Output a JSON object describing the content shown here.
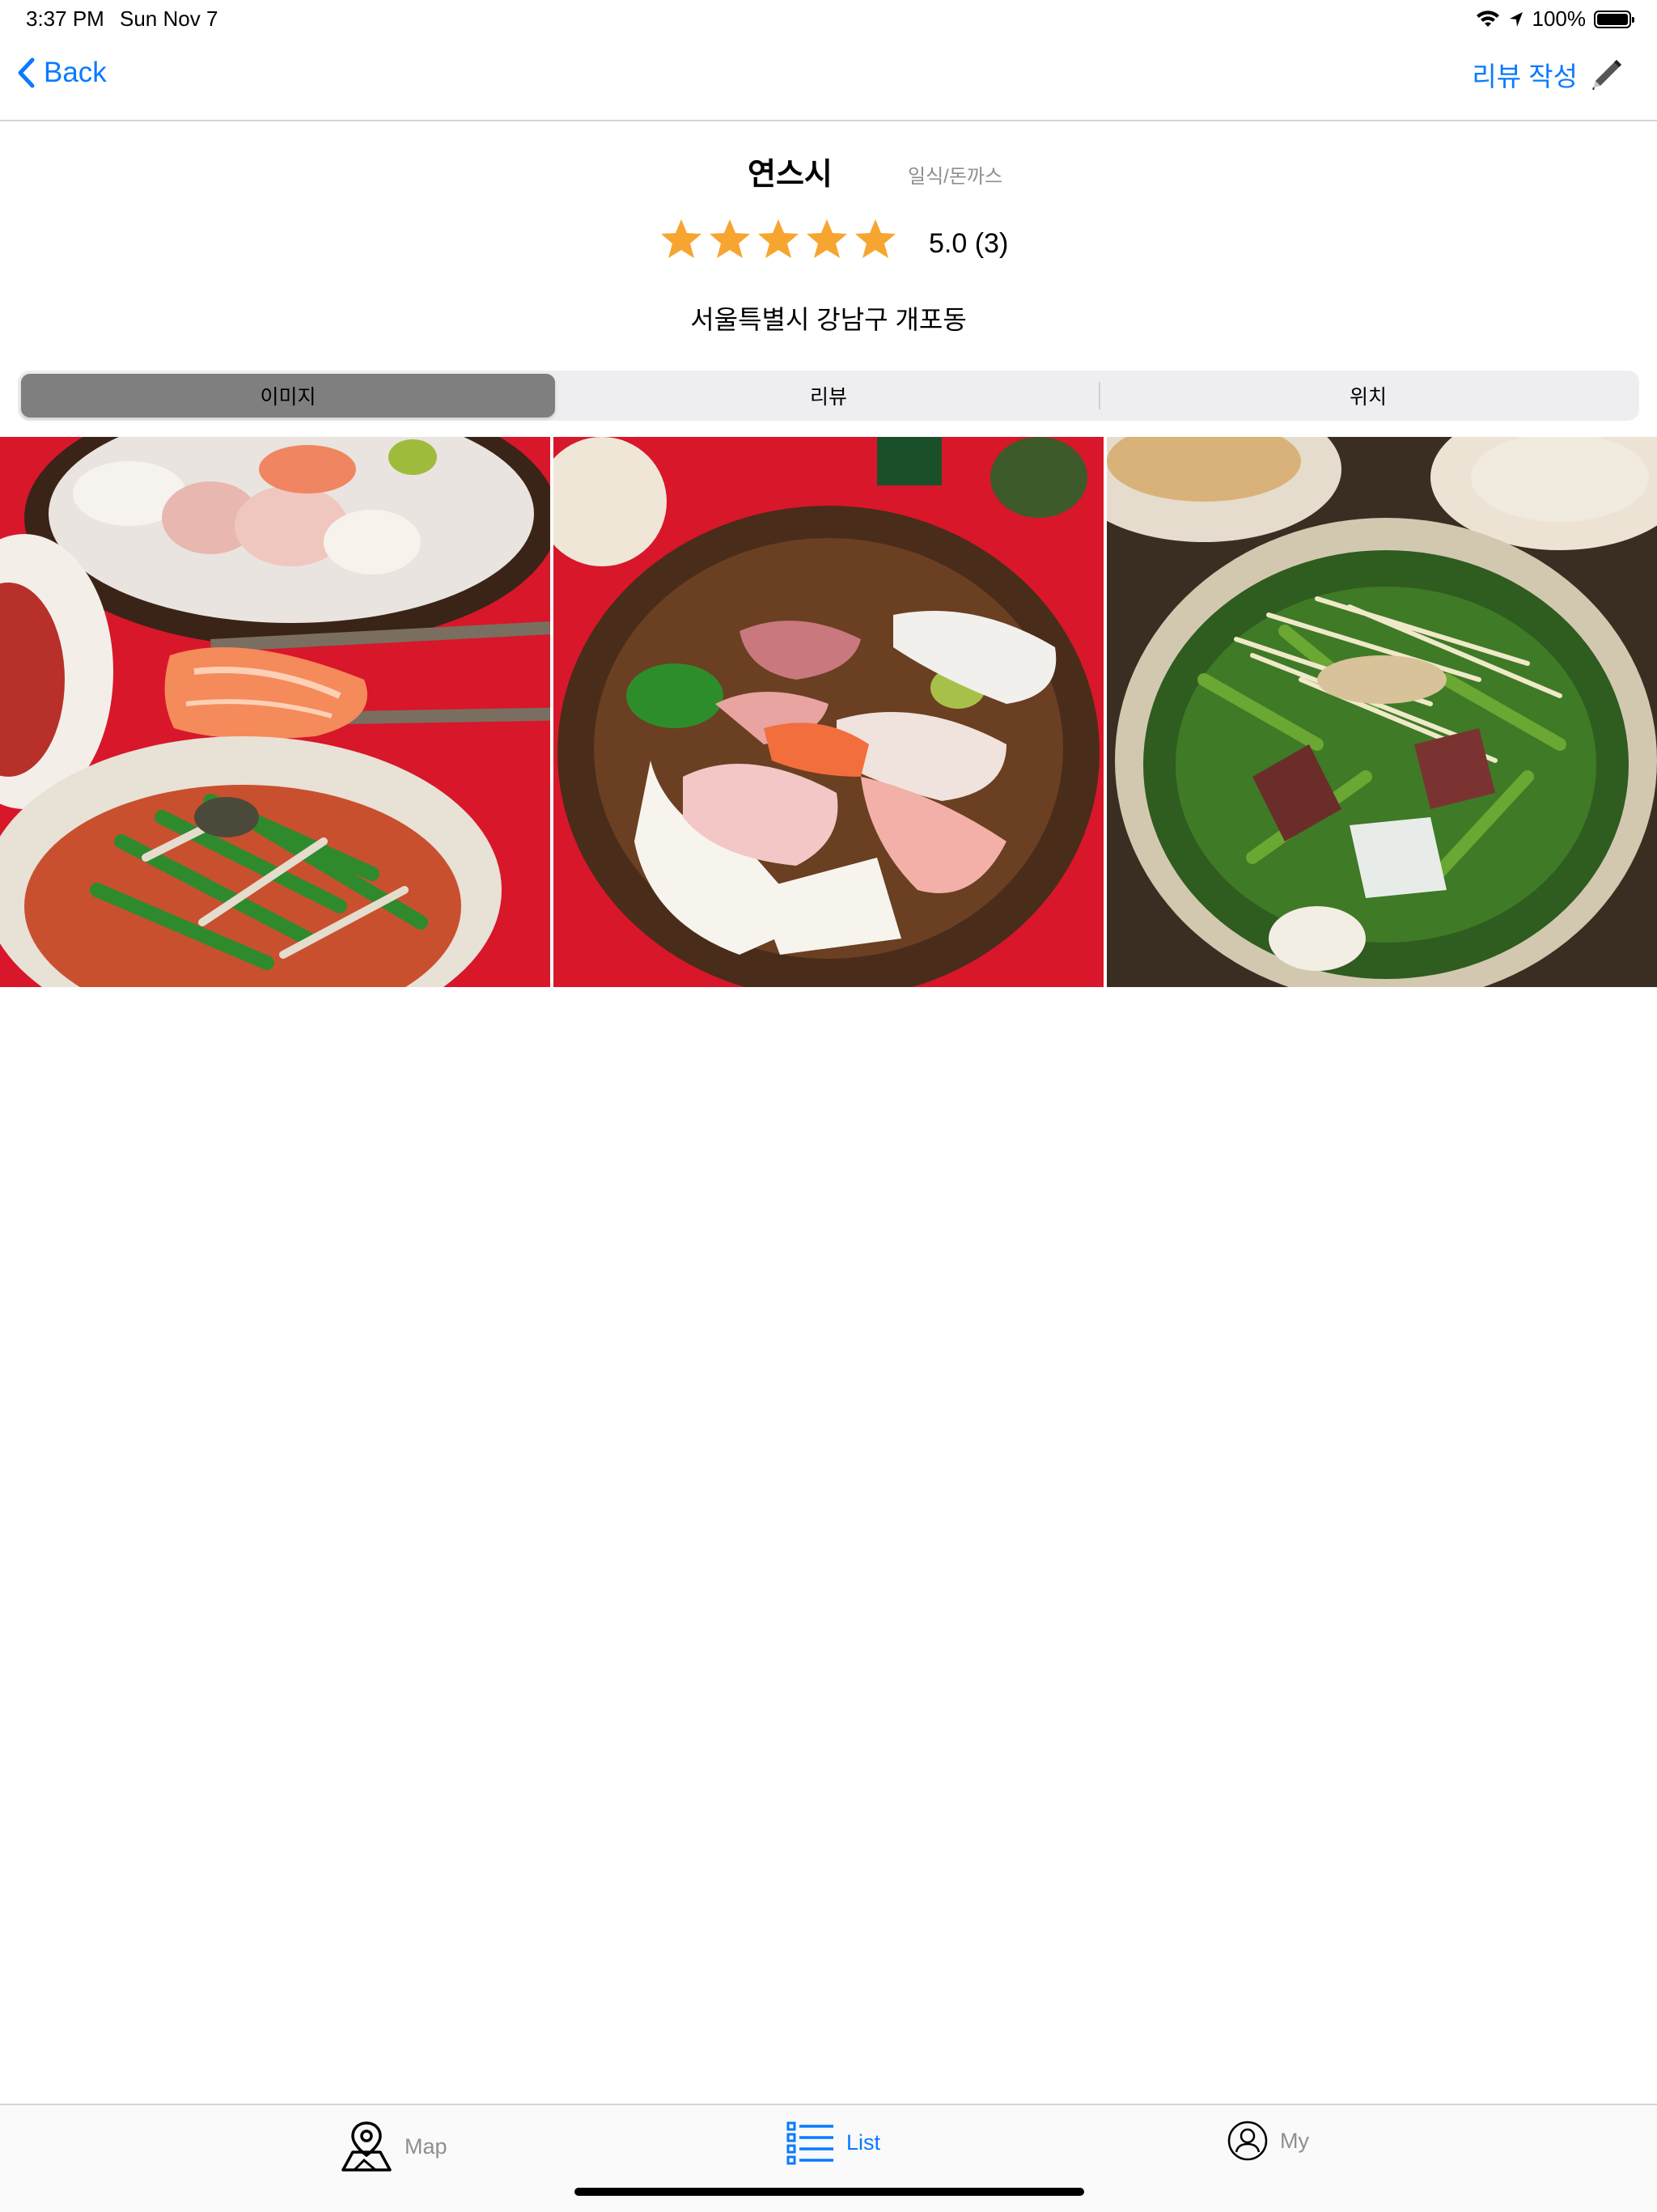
{
  "status_bar": {
    "time": "3:37 PM",
    "date": "Sun Nov 7",
    "battery": "100%"
  },
  "nav": {
    "back_label": "Back",
    "write_review_label": "리뷰 작성"
  },
  "restaurant": {
    "name": "연스시",
    "category": "일식/돈까스",
    "rating_text": "5.0 (3)",
    "rating_value": 5.0,
    "review_count": 3,
    "address": "서울특별시 강남구 개포동"
  },
  "segments": [
    {
      "label": "이미지",
      "active": true
    },
    {
      "label": "리뷰",
      "active": false
    },
    {
      "label": "위치",
      "active": false
    }
  ],
  "photos": [
    {
      "name": "salmon-sashimi-photo"
    },
    {
      "name": "sashimi-platter-photo"
    },
    {
      "name": "hoe-salad-photo"
    }
  ],
  "tabs": [
    {
      "label": "Map",
      "icon": "map-pin-icon",
      "active": false
    },
    {
      "label": "List",
      "icon": "list-icon",
      "active": true
    },
    {
      "label": "My",
      "icon": "person-icon",
      "active": false
    }
  ],
  "colors": {
    "accent": "#0a7aff",
    "star": "#f7a531",
    "inactive": "#8e8e93",
    "segment_active": "#7f7f7f"
  }
}
